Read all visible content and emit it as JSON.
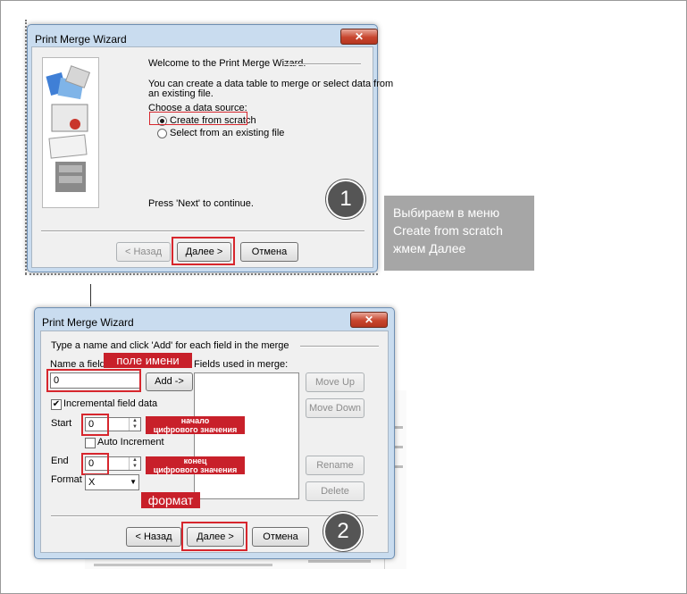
{
  "step1": {
    "dialog_title": "Print Merge Wizard",
    "close_glyph": "✕",
    "welcome": "Welcome to the Print Merge Wizard.",
    "description_line1": "You can create a data table to merge or select data from",
    "description_line2": "an existing file.",
    "choose_label": "Choose a data source:",
    "option_create": "Create from scratch",
    "option_select": "Select from an existing file",
    "press_next": "Press 'Next' to continue.",
    "back_label": "< Назад",
    "next_label": "Далее >",
    "cancel_label": "Отмена",
    "badge": "1",
    "note": "Выбираем в меню\nCreate from scratch\nжмем Далее"
  },
  "step2": {
    "dialog_title": "Print Merge Wizard",
    "close_glyph": "✕",
    "instruction": "Type a name and click 'Add' for each field in the merge",
    "name_field_label": "Name a field:",
    "name_field_value": "0",
    "add_label": "Add ->",
    "fields_used_label": "Fields used in merge:",
    "move_up_label": "Move Up",
    "move_down_label": "Move Down",
    "incremental_label": "Incremental field data",
    "start_label": "Start",
    "start_value": "0",
    "auto_increment_label": "Auto Increment",
    "end_label": "End",
    "end_value": "0",
    "format_label": "Format",
    "format_value": "X",
    "rename_label": "Rename",
    "delete_label": "Delete",
    "back_label": "< Назад",
    "next_label": "Далее >",
    "cancel_label": "Отмена",
    "badge": "2",
    "tag_name": "поле имени",
    "tag_start_line1": "начало",
    "tag_start_line2": "цифрового значения",
    "tag_end_line1": "конец",
    "tag_end_line2": "цифрового значения",
    "tag_format": "формат"
  }
}
